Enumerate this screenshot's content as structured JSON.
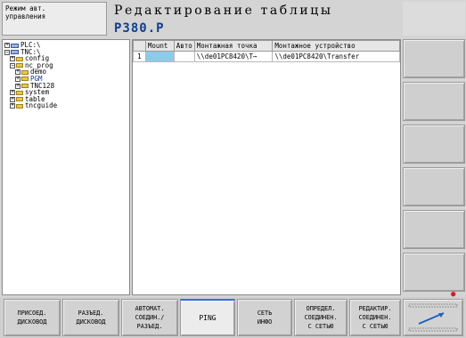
{
  "header": {
    "mode_line1": "Режим авт.",
    "mode_line2": "управления",
    "title": "Редактирование таблицы",
    "file": "P380.P"
  },
  "tree": {
    "items": [
      {
        "label": "PLC:\\",
        "type": "drive",
        "expander": "⊞"
      },
      {
        "label": "TNC:\\",
        "type": "drive",
        "expander": "⊟"
      },
      {
        "label": "config",
        "type": "folder",
        "expander": "⊞"
      },
      {
        "label": "nc_prog",
        "type": "folder",
        "expander": "⊟"
      },
      {
        "label": "demo",
        "type": "folder",
        "expander": "⊞"
      },
      {
        "label": "PGM",
        "type": "folder",
        "expander": "⊞"
      },
      {
        "label": "TNC128",
        "type": "folder",
        "expander": "⊞"
      },
      {
        "label": "system",
        "type": "folder",
        "expander": "⊞"
      },
      {
        "label": "table",
        "type": "folder",
        "expander": "⊞"
      },
      {
        "label": "tncguide",
        "type": "folder",
        "expander": "⊞"
      }
    ]
  },
  "table": {
    "columns": [
      "",
      "Mount",
      "Авто",
      "Монтажная точка",
      "Монтажное устройство"
    ],
    "rows": [
      {
        "num": "1",
        "mount": "",
        "avto": "",
        "point": "\\\\de01PC8420\\T⋯",
        "device": "\\\\de01PC8420\\Transfer"
      }
    ]
  },
  "softkeys": [
    {
      "line1": "ПРИСОЕД.",
      "line2": "ДИСКОВОД",
      "line3": ""
    },
    {
      "line1": "РАЗЪЕД.",
      "line2": "ДИСКОВОД",
      "line3": ""
    },
    {
      "line1": "АВТОМАТ.",
      "line2": "СОЕДИН./",
      "line3": "РАЗЪЕД."
    },
    {
      "line1": "PING",
      "line2": "",
      "line3": ""
    },
    {
      "line1": "СЕТЬ",
      "line2": "ИНФО",
      "line3": ""
    },
    {
      "line1": "ОПРЕДЕЛ.",
      "line2": "СОЕДИНЕН.",
      "line3": "С СЕТЬЮ"
    },
    {
      "line1": "РЕДАКТИР.",
      "line2": "СОЕДИНЕН.",
      "line3": "С СЕТЬЮ"
    }
  ],
  "colors": {
    "accent": "#0f3f8f",
    "selected_cell": "#8ecaea",
    "active_key": "#3a6fd0"
  },
  "icons": {
    "nav_icon": "navigation-arrow-icon",
    "indicator": "status-indicator-icon"
  }
}
